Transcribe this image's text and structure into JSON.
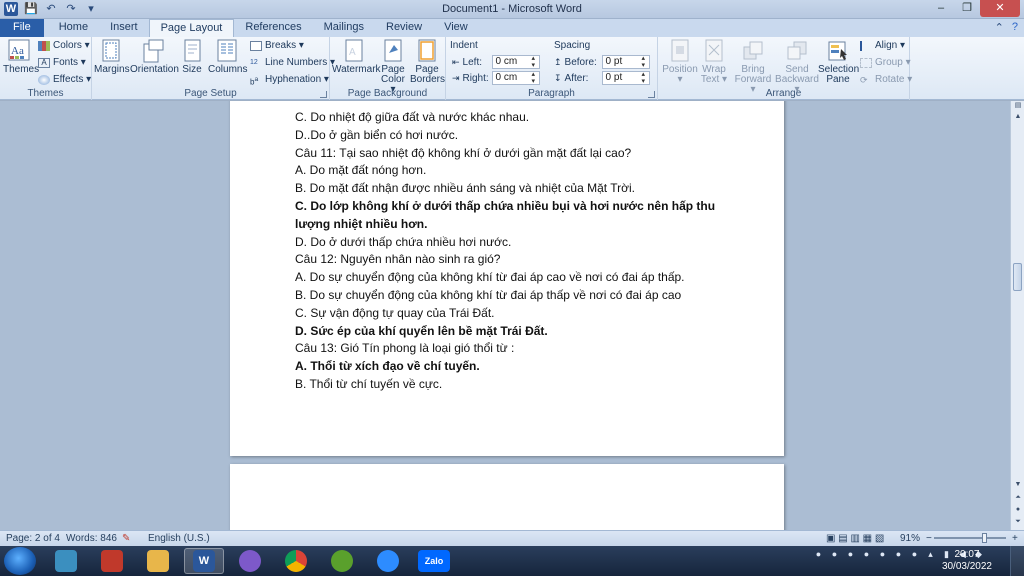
{
  "window": {
    "title": "Document1 - Microsoft Word",
    "controls": {
      "minimize": "‒",
      "restore": "❐",
      "close": "✕"
    }
  },
  "qat": {
    "app_icon": "W",
    "save": "💾",
    "undo": "↶",
    "redo": "↷",
    "customize": "▾"
  },
  "tabs": [
    {
      "label": "File"
    },
    {
      "label": "Home"
    },
    {
      "label": "Insert"
    },
    {
      "label": "Page Layout"
    },
    {
      "label": "References"
    },
    {
      "label": "Mailings"
    },
    {
      "label": "Review"
    },
    {
      "label": "View"
    }
  ],
  "ribbon": {
    "themes": {
      "themes_btn": "Themes",
      "colors": "Colors ▾",
      "fonts": "Fonts ▾",
      "effects": "Effects ▾",
      "label": "Themes"
    },
    "page_setup": {
      "margins": "Margins",
      "orientation": "Orientation",
      "size": "Size",
      "columns": "Columns",
      "breaks": "Breaks ▾",
      "line_numbers": "Line Numbers ▾",
      "hyphenation": "Hyphenation ▾",
      "label": "Page Setup"
    },
    "page_background": {
      "watermark": "Watermark",
      "page_color_1": "Page",
      "page_color_2": "Color ▾",
      "page_borders_1": "Page",
      "page_borders_2": "Borders",
      "label": "Page Background"
    },
    "paragraph": {
      "indent_heading": "Indent",
      "left_label": "Left:",
      "left_value": "0 cm",
      "right_label": "Right:",
      "right_value": "0 cm",
      "spacing_heading": "Spacing",
      "before_label": "Before:",
      "before_value": "0 pt",
      "after_label": "After:",
      "after_value": "0 pt",
      "label": "Paragraph"
    },
    "arrange": {
      "position_1": "Position",
      "position_2": "▾",
      "wrap_text_1": "Wrap",
      "wrap_text_2": "Text ▾",
      "bring_forward_1": "Bring",
      "bring_forward_2": "Forward ▾",
      "send_backward_1": "Send",
      "send_backward_2": "Backward ▾",
      "selection_pane_1": "Selection",
      "selection_pane_2": "Pane",
      "align": "Align ▾",
      "group": "Group ▾",
      "rotate": "Rotate ▾",
      "label": "Arrange"
    }
  },
  "document": {
    "lines": [
      {
        "text": " C. Do nhiệt độ giữa đất và nước khác nhau.",
        "bold": false
      },
      {
        "text": "D..Do ở gần biển có hơi nước.",
        "bold": false
      },
      {
        "text": "Câu 11: Tại sao nhiệt độ không khí ở dưới gần mặt đất lại cao?",
        "bold": false
      },
      {
        "text": "A. Do mặt đất nóng hơn.",
        "bold": false
      },
      {
        "text": "B. Do mặt đất nhận được nhiều ánh sáng và nhiệt của Mặt Trời.",
        "bold": false
      },
      {
        "text": "C. Do lớp không khí ở dưới thấp chứa nhiều bụi và hơi nước nên hấp thu lượng nhiệt nhiều hơn.",
        "bold": true
      },
      {
        "text": "D. Do ở dưới thấp chứa nhiều hơi nước.",
        "bold": false
      },
      {
        "text": "Câu 12: Nguyên nhân nào sinh ra gió?",
        "bold": false
      },
      {
        "text": "A. Do sự chuyển động của không khí từ đai áp cao về nơi có đai áp thấp.",
        "bold": false
      },
      {
        "text": "B. Do sự chuyển động của không khí từ đai áp thấp về nơi có đai áp cao",
        "bold": false
      },
      {
        "text": "C. Sự vận động tự quay của Trái Đất.",
        "bold": false
      },
      {
        "text": " D. Sức ép của khí quyển lên bề mặt Trái Đất.",
        "bold": true
      },
      {
        "text": "Câu 13: Gió Tín phong là loại gió thổi từ :",
        "bold": false
      },
      {
        "text": "A. Thổi từ xích đạo về chí tuyến.",
        "bold": true
      },
      {
        "text": "B. Thổi từ chí tuyến về cực.",
        "bold": false
      }
    ]
  },
  "status": {
    "page": "Page: 2 of 4",
    "words": "Words: 846",
    "language": "English (U.S.)",
    "zoom": "91%",
    "zoom_minus": "−",
    "zoom_plus": "+"
  },
  "taskbar": {
    "zalo_label": "Zalo",
    "word_label": "W",
    "time": "20:07",
    "date": "30/03/2022"
  },
  "colors": {
    "file_tab": "#2a5ea8",
    "word_blue": "#2b579a",
    "taskbar": "#1d2e48"
  }
}
